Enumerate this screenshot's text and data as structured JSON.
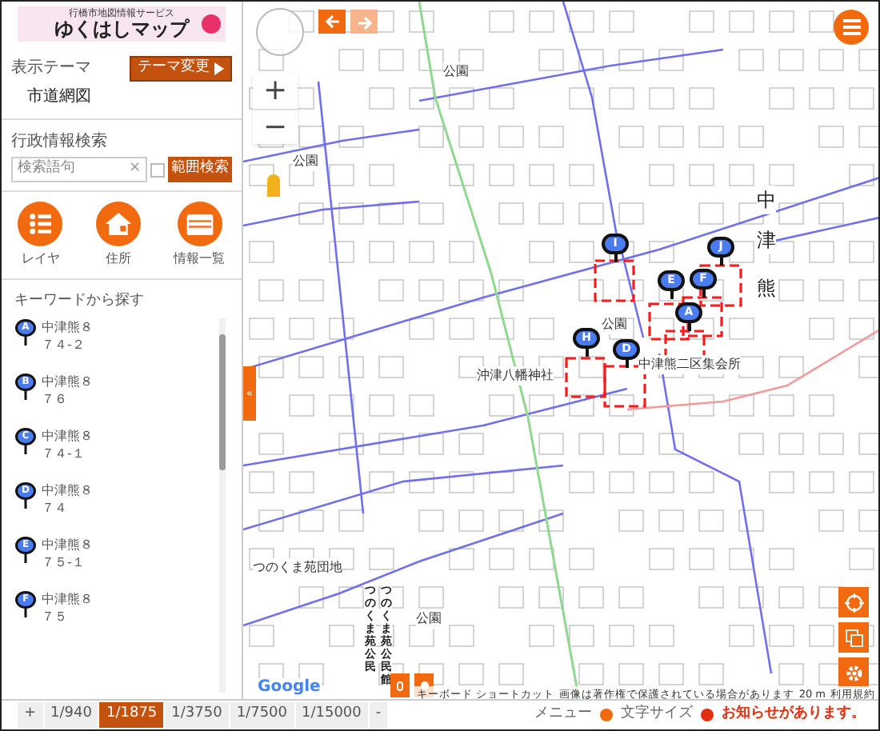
{
  "logo": {
    "subtitle": "行橋市地図情報サービス",
    "title": "ゆくはしマップ"
  },
  "theme": {
    "label": "表示テーマ",
    "value": "市道網図",
    "button": "テーマ変更"
  },
  "admin_search": {
    "label": "行政情報検索",
    "placeholder": "検索語句",
    "clear": "×",
    "button": "範囲検索"
  },
  "tools": [
    {
      "label": "レイヤ",
      "kind": "list"
    },
    {
      "label": "住所",
      "kind": "house"
    },
    {
      "label": "情報一覧",
      "kind": "panel"
    }
  ],
  "keyword": {
    "title": "キーワードから探す",
    "results": [
      {
        "marker": "A",
        "line1": "中津熊８",
        "line2": "７４-２"
      },
      {
        "marker": "B",
        "line1": "中津熊８",
        "line2": "７６"
      },
      {
        "marker": "C",
        "line1": "中津熊８",
        "line2": "７４-１"
      },
      {
        "marker": "D",
        "line1": "中津熊８",
        "line2": "７４"
      },
      {
        "marker": "E",
        "line1": "中津熊８",
        "line2": "７５-１"
      },
      {
        "marker": "F",
        "line1": "中津熊８",
        "line2": "７５"
      }
    ]
  },
  "map": {
    "zoom_in": "+",
    "zoom_out": "−",
    "collapse": "«",
    "labels": [
      {
        "text": "公園",
        "kind": "h"
      },
      {
        "text": "公園",
        "kind": "h"
      },
      {
        "text": "公園",
        "kind": "h"
      },
      {
        "text": "公園",
        "kind": "h"
      },
      {
        "text": "中",
        "kind": "big"
      },
      {
        "text": "津",
        "kind": "big"
      },
      {
        "text": "熊",
        "kind": "big"
      },
      {
        "text": "沖津八幡神社",
        "kind": "h"
      },
      {
        "text": "中津熊二区集会所",
        "kind": "h"
      },
      {
        "text": "つのくま苑団地",
        "kind": "h"
      },
      {
        "text": "つのくま苑公民",
        "kind": "v"
      },
      {
        "text": "つのくま苑公民館",
        "kind": "v"
      }
    ],
    "markers": [
      {
        "letter": "I"
      },
      {
        "letter": "J"
      },
      {
        "letter": "E"
      },
      {
        "letter": "F"
      },
      {
        "letter": "A"
      },
      {
        "letter": "H"
      },
      {
        "letter": "D"
      }
    ],
    "google": "Google",
    "attribution": [
      "キーボード ショートカット",
      "画像は著作権で保護されている場合があります",
      "20 m",
      "利用規約"
    ]
  },
  "scales": [
    {
      "label": "+",
      "selected": false
    },
    {
      "label": "1/940",
      "selected": false
    },
    {
      "label": "1/1875",
      "selected": true
    },
    {
      "label": "1/3750",
      "selected": false
    },
    {
      "label": "1/7500",
      "selected": false
    },
    {
      "label": "1/15000",
      "selected": false
    },
    {
      "label": "-",
      "selected": false
    }
  ],
  "footer": {
    "menu": "メニュー",
    "font_size": "文字サイズ",
    "notice": "お知らせがあります。"
  }
}
